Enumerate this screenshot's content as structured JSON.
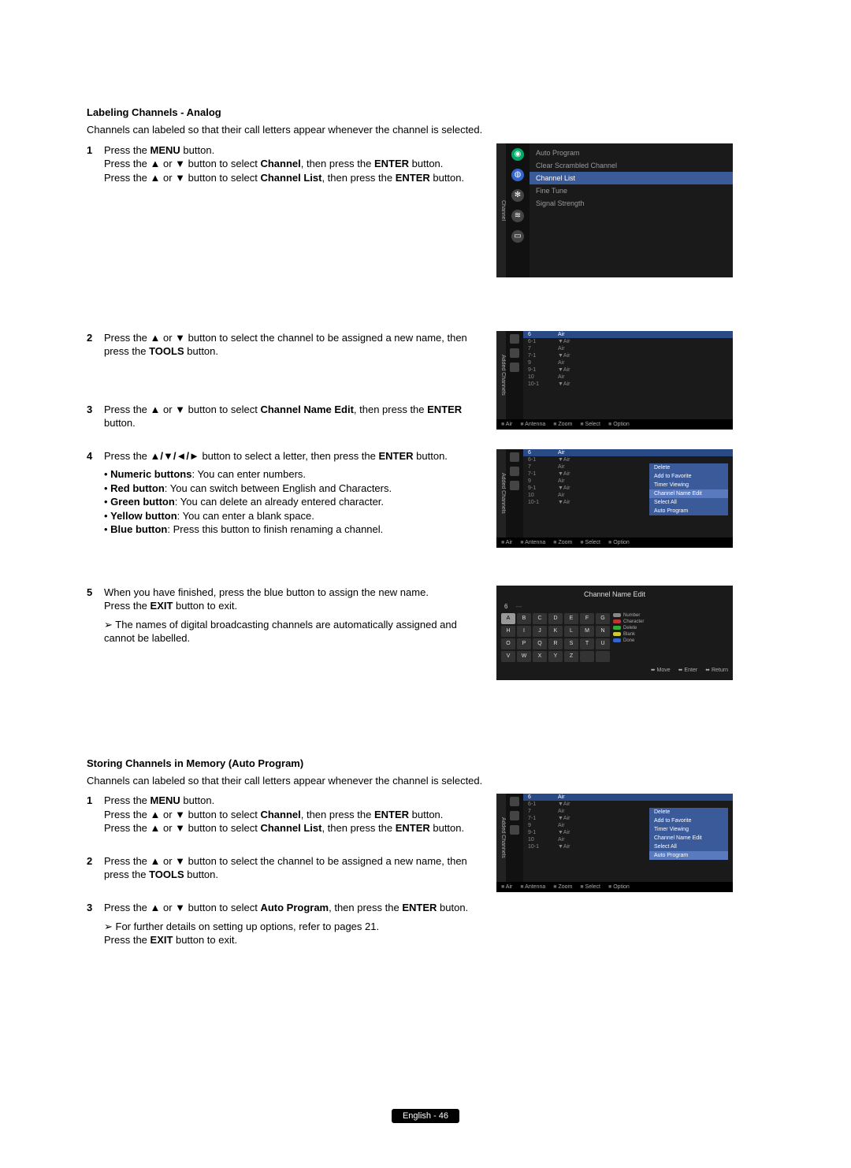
{
  "section1": {
    "title": "Labeling Channels - Analog",
    "intro": "Channels can labeled so that their call letters appear whenever the channel is selected.",
    "steps": {
      "s1": {
        "l1a": "Press the ",
        "l1b": "MENU",
        "l1c": " button.",
        "l2a": "Press the ▲ or ▼ button to select ",
        "l2b": "Channel",
        "l2c": ", then press the ",
        "l2d": "ENTER",
        "l2e": " button.",
        "l3a": "Press the ▲ or ▼ button to select ",
        "l3b": "Channel List",
        "l3c": ", then press the ",
        "l3d": "ENTER",
        "l3e": " button."
      },
      "s2": {
        "l1a": "Press the ▲ or ▼ button to select the channel to be assigned a new name, then press the ",
        "l1b": "TOOLS",
        "l1c": " button."
      },
      "s3": {
        "l1a": "Press the ▲ or ▼ button to select ",
        "l1b": "Channel Name Edit",
        "l1c": ", then press the ",
        "l1d": "ENTER",
        "l1e": " button."
      },
      "s4": {
        "l1a": "Press the ",
        "l1b": "▲/▼/◄/►",
        "l1c": " button to select a letter, then press the ",
        "l1d": "ENTER",
        "l1e": " button.",
        "b1a": "Numeric buttons",
        "b1b": ": You can enter numbers.",
        "b2a": "Red button",
        "b2b": ": You can switch between English and Characters.",
        "b3a": "Green button",
        "b3b": ": You can delete an already entered character.",
        "b4a": "Yellow button",
        "b4b": ": You can enter a blank space.",
        "b5a": "Blue button",
        "b5b": ": Press this button to finish renaming a channel."
      },
      "s5": {
        "l1": "When you have finished, press the blue button to assign the new name.",
        "l2a": "Press the ",
        "l2b": "EXIT",
        "l2c": " button to exit.",
        "note": "The names of digital broadcasting channels are automatically assigned and cannot be labelled."
      }
    }
  },
  "section2": {
    "title": "Storing Channels in Memory (Auto Program)",
    "intro": "Channels can labeled so that their call letters appear whenever the channel is selected.",
    "steps": {
      "s1": {
        "l1a": "Press the ",
        "l1b": "MENU",
        "l1c": " button.",
        "l2a": "Press the ▲ or ▼ button to select ",
        "l2b": "Channel",
        "l2c": ", then press the ",
        "l2d": "ENTER",
        "l2e": " button.",
        "l3a": "Press the ▲ or ▼ button to select ",
        "l3b": "Channel List",
        "l3c": ", then press the ",
        "l3d": "ENTER",
        "l3e": " button."
      },
      "s2": {
        "l1a": "Press the ▲ or ▼ button to select the channel to be assigned a new name, then press the ",
        "l1b": "TOOLS",
        "l1c": " button."
      },
      "s3": {
        "l1a": "Press the ▲ or ▼ button to select ",
        "l1b": "Auto Program",
        "l1c": ", then press the ",
        "l1d": "ENTER",
        "l1e": " buton.",
        "note": "For further details on setting up options, refer to pages 21.",
        "l2a": "Press the ",
        "l2b": "EXIT",
        "l2c": " button to exit."
      }
    }
  },
  "osd1": {
    "sidelabel": "Channel",
    "items": [
      "Auto Program",
      "Clear Scrambled Channel",
      "Channel List",
      "Fine Tune",
      "Signal Strength"
    ],
    "hlIndex": 2
  },
  "osd2": {
    "sidelabel": "Added Channels",
    "rows": [
      {
        "ch": "6",
        "src": "Air"
      },
      {
        "ch": "6-1",
        "src": "▼Air"
      },
      {
        "ch": "7",
        "src": "Air"
      },
      {
        "ch": "7-1",
        "src": "▼Air"
      },
      {
        "ch": "9",
        "src": "Air"
      },
      {
        "ch": "9-1",
        "src": "▼Air"
      },
      {
        "ch": "10",
        "src": "Air"
      },
      {
        "ch": "10-1",
        "src": "▼Air"
      }
    ],
    "footer": [
      "Air",
      "Antenna",
      "Zoom",
      "Select",
      "Option"
    ]
  },
  "osd3": {
    "sidelabel": "Added Channels",
    "rows": [
      {
        "ch": "6",
        "src": "Air"
      },
      {
        "ch": "6-1",
        "src": "▼Air"
      },
      {
        "ch": "7",
        "src": "Air"
      },
      {
        "ch": "7-1",
        "src": "▼Air"
      },
      {
        "ch": "9",
        "src": "Air"
      },
      {
        "ch": "9-1",
        "src": "▼Air"
      },
      {
        "ch": "10",
        "src": "Air"
      },
      {
        "ch": "10-1",
        "src": "▼Air"
      }
    ],
    "popup": [
      "Delete",
      "Add to Favorite",
      "Timer Viewing",
      "Channel Name Edit",
      "Select All",
      "Auto Program"
    ],
    "popupHl": 3,
    "footer": [
      "Air",
      "Antenna",
      "Zoom",
      "Select",
      "Option"
    ]
  },
  "osd4": {
    "title": "Channel Name Edit",
    "ch": "6",
    "keys": [
      [
        "A",
        "B",
        "C",
        "D",
        "E",
        "F",
        "G"
      ],
      [
        "H",
        "I",
        "J",
        "K",
        "L",
        "M",
        "N"
      ],
      [
        "O",
        "P",
        "Q",
        "R",
        "S",
        "T",
        "U"
      ],
      [
        "V",
        "W",
        "X",
        "Y",
        "Z",
        "",
        ""
      ]
    ],
    "legend": [
      {
        "color": "#888",
        "label": "Number"
      },
      {
        "color": "#b33",
        "label": "Character"
      },
      {
        "color": "#3a3",
        "label": "Delete"
      },
      {
        "color": "#cc3",
        "label": "Blank"
      },
      {
        "color": "#36c",
        "label": "Done"
      }
    ],
    "foot": [
      "Move",
      "Enter",
      "Return"
    ]
  },
  "osd5": {
    "sidelabel": "Added Channels",
    "rows": [
      {
        "ch": "6",
        "src": "Air"
      },
      {
        "ch": "6-1",
        "src": "▼Air"
      },
      {
        "ch": "7",
        "src": "Air"
      },
      {
        "ch": "7-1",
        "src": "▼Air"
      },
      {
        "ch": "9",
        "src": "Air"
      },
      {
        "ch": "9-1",
        "src": "▼Air"
      },
      {
        "ch": "10",
        "src": "Air"
      },
      {
        "ch": "10-1",
        "src": "▼Air"
      }
    ],
    "popup": [
      "Delete",
      "Add to Favorite",
      "Timer Viewing",
      "Channel Name Edit",
      "Select All",
      "Auto Program"
    ],
    "popupHl": 5,
    "footer": [
      "Air",
      "Antenna",
      "Zoom",
      "Select",
      "Option"
    ]
  },
  "footer": "English - 46"
}
